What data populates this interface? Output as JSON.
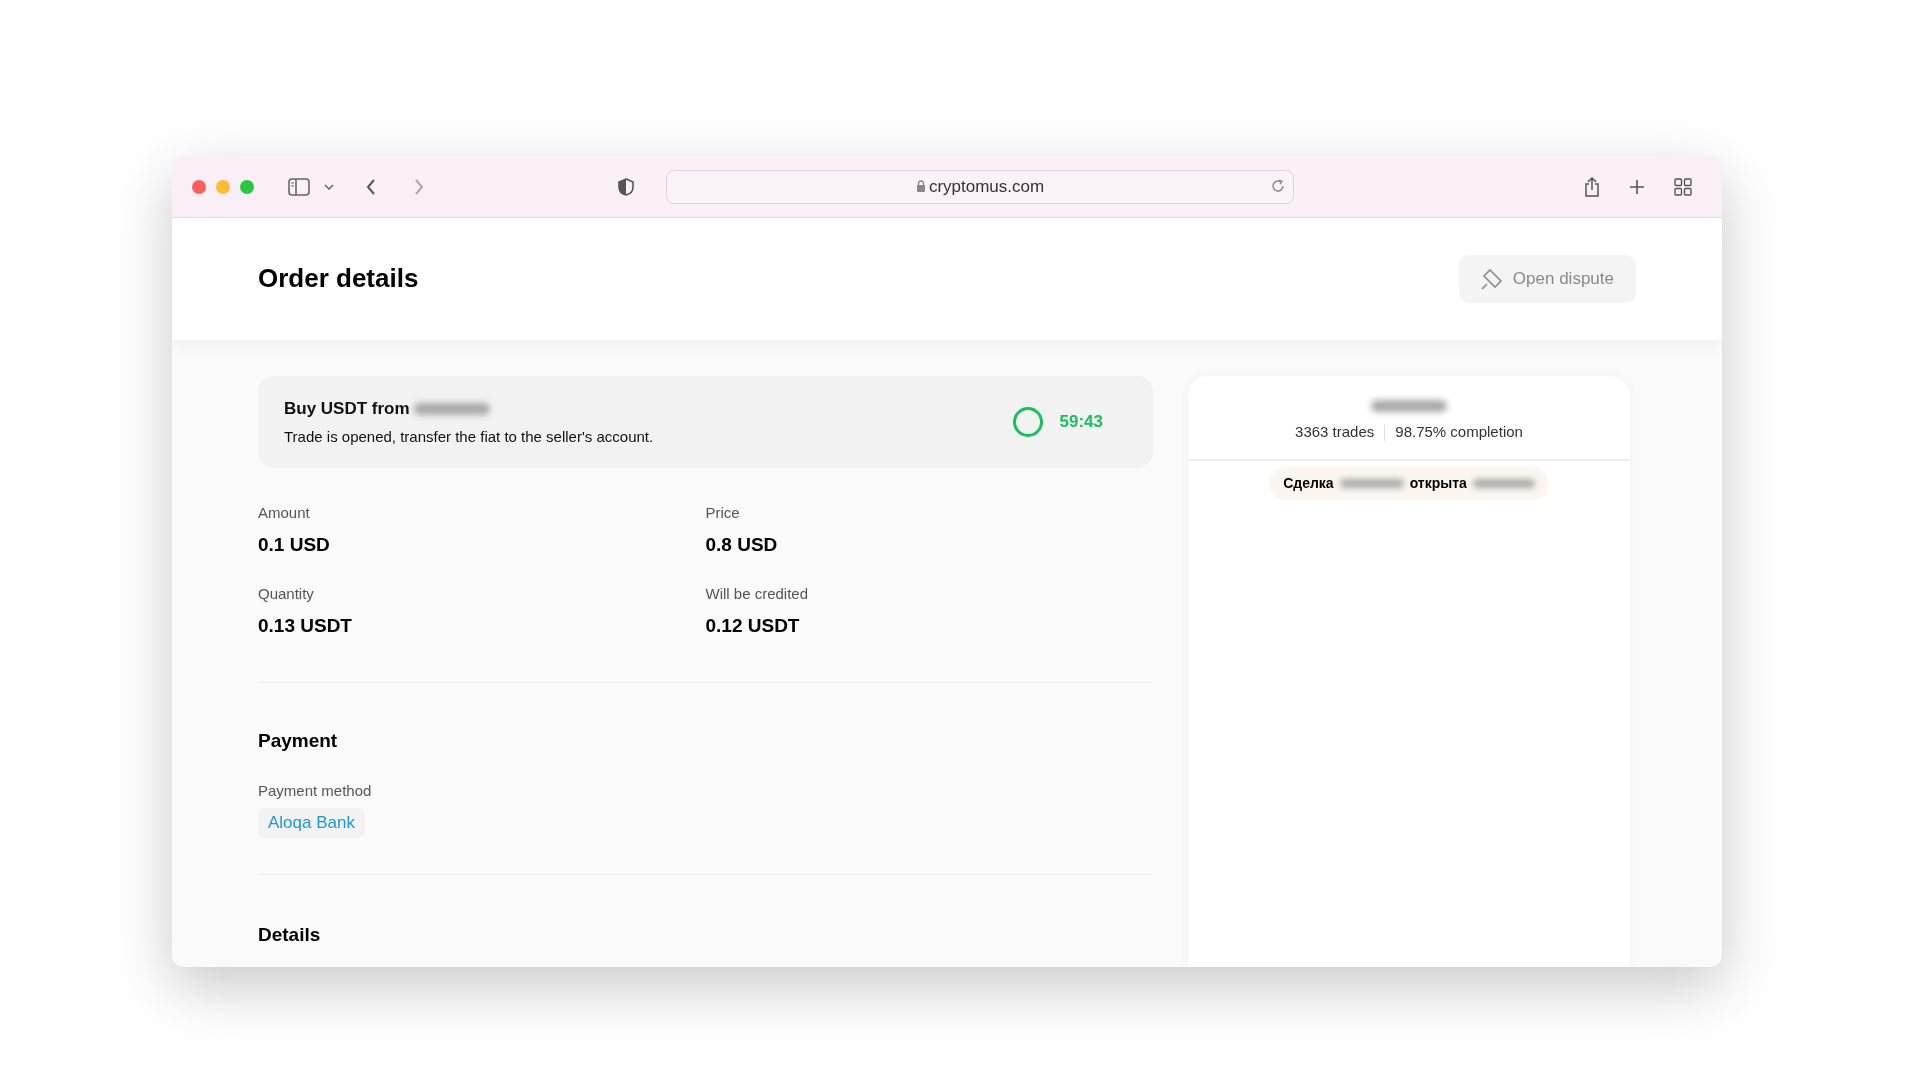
{
  "browser": {
    "url": "cryptomus.com"
  },
  "header": {
    "title": "Order details",
    "dispute_button": {
      "label": "Open dispute",
      "disabled": true
    }
  },
  "trade_banner": {
    "title": "Buy USDT from",
    "message": "Trade is opened, transfer the fiat to the seller's account.",
    "timer": "59:43",
    "color": "#17c15b"
  },
  "fields": [
    {
      "label": "Amount",
      "value": "0.1 USD"
    },
    {
      "label": "Price",
      "value": "0.8 USD"
    },
    {
      "label": "Quantity",
      "value": "0.13 USDT"
    },
    {
      "label": "Will be credited",
      "value": "0.12 USDT"
    }
  ],
  "payment": {
    "heading": "Payment",
    "method_label": "Payment method",
    "method": "Aloqa Bank"
  },
  "details": {
    "heading": "Details"
  },
  "seller": {
    "trades": "3363 trades",
    "completion": "98.75% completion"
  },
  "chat": {
    "message_parts": [
      "Сделка",
      "открыта"
    ]
  }
}
